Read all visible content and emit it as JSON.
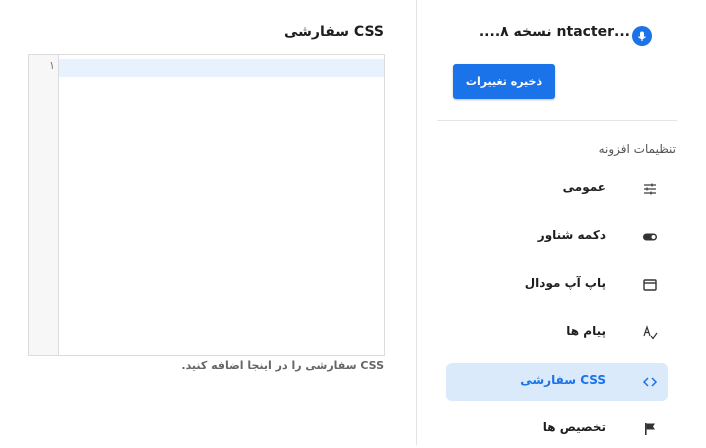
{
  "header": {
    "plugin_title": "...ntacter نسخه ۸.‌...",
    "save_label": "ذخیره تغییرات",
    "accent_color": "#1a73e8"
  },
  "sidebar": {
    "section_label": "تنظیمات افزونه",
    "items": [
      {
        "label": "عمومی",
        "icon": "sliders-icon",
        "active": false
      },
      {
        "label": "دکمه شناور",
        "icon": "toggle-icon",
        "active": false
      },
      {
        "label": "پاپ آپ مودال",
        "icon": "window-icon",
        "active": false
      },
      {
        "label": "پیام ها",
        "icon": "text-spellcheck-icon",
        "active": false
      },
      {
        "label": "CSS سفارشی",
        "icon": "code-icon",
        "active": true
      },
      {
        "label": "تخصیص ها",
        "icon": "flag-icon",
        "active": false
      }
    ]
  },
  "editor": {
    "title": "CSS سفارشی",
    "line_numbers": [
      "۱"
    ],
    "content": "",
    "help_text": "CSS سفارشی را در اینجا اضافه کنید."
  }
}
